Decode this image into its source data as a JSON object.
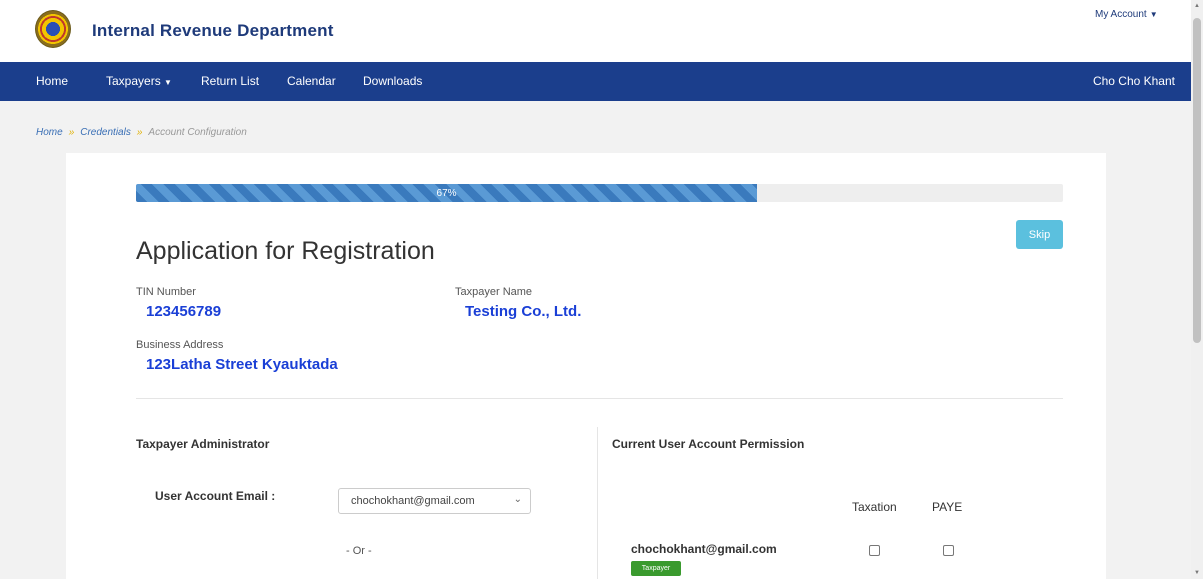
{
  "header": {
    "brand": "Internal Revenue Department",
    "my_account": "My Account",
    "logo_icon": "department-seal"
  },
  "nav": {
    "items": [
      {
        "label": "Home"
      },
      {
        "label": "Taxpayers"
      },
      {
        "label": "Return List"
      },
      {
        "label": "Calendar"
      },
      {
        "label": "Downloads"
      }
    ],
    "user": "Cho Cho Khant"
  },
  "breadcrumb": {
    "home": "Home",
    "credentials": "Credentials",
    "current": "Account Configuration",
    "separator": "»"
  },
  "progress": {
    "value": 67,
    "label": "67%"
  },
  "skip_label": "Skip",
  "form": {
    "title": "Application for Registration",
    "tin_label": "TIN Number",
    "tin_value": "123456789",
    "name_label": "Taxpayer Name",
    "name_value": "Testing Co., Ltd.",
    "address_label": "Business Address",
    "address_value": "123Latha Street Kyauktada"
  },
  "admin": {
    "heading": "Taxpayer Administrator",
    "email_label": "User Account Email :",
    "email_selected": "chochokhant@gmail.com",
    "or_text": "- Or -"
  },
  "permissions": {
    "heading": "Current User Account Permission",
    "columns": [
      "Taxation",
      "PAYE"
    ],
    "rows": [
      {
        "email": "chochokhant@gmail.com",
        "badge": "Taxpayer",
        "taxation": false,
        "paye": false
      }
    ]
  },
  "colors": {
    "navbar": "#1b3e8c",
    "brand": "#1e3a7a",
    "value_blue": "#1a3fd6",
    "skip": "#5bc0de",
    "badge": "#3a9a2e"
  }
}
